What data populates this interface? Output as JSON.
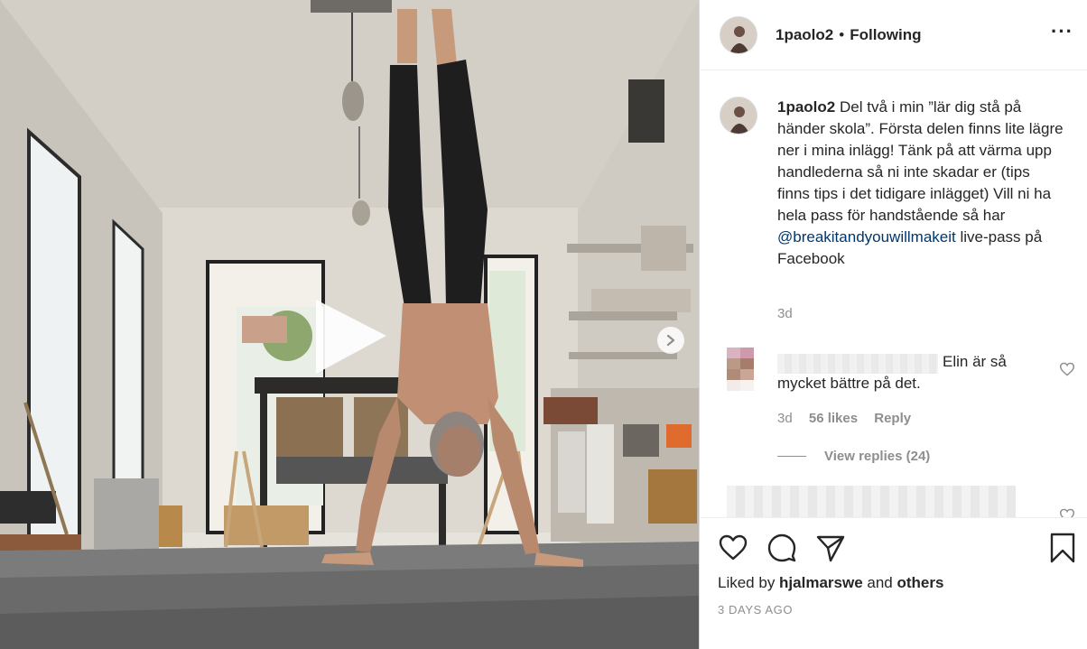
{
  "post": {
    "username": "1paolo2",
    "separator": "•",
    "follow_status": "Following",
    "more_glyph": "···"
  },
  "caption": {
    "username": "1paolo2",
    "text_before": "Del två i min ”lär dig stå på händer skola”. Första delen finns lite lägre ner i mina inlägg! Tänk på att värma upp handlederna så ni inte skadar er (tips finns tips i det tidigare inlägget) Vill ni ha hela pass för handstående så har ",
    "mention": "@breakitandyouwillmakeit",
    "text_after": " live-pass på Facebook",
    "time": "3d"
  },
  "comment": {
    "text": "Elin är så mycket bättre på det.",
    "time": "3d",
    "likes": "56 likes",
    "reply_label": "Reply",
    "view_replies": "View replies (24)"
  },
  "footer": {
    "liked_prefix": "Liked by ",
    "liked_user": "hjalmarswe",
    "liked_and": " and ",
    "liked_others": "others",
    "timestamp": "3 DAYS AGO"
  },
  "icons": {
    "like": "heart-icon",
    "comment": "speech-bubble-icon",
    "share": "paper-plane-icon",
    "save": "bookmark-icon",
    "play": "play-icon",
    "next": "chevron-right-icon"
  }
}
